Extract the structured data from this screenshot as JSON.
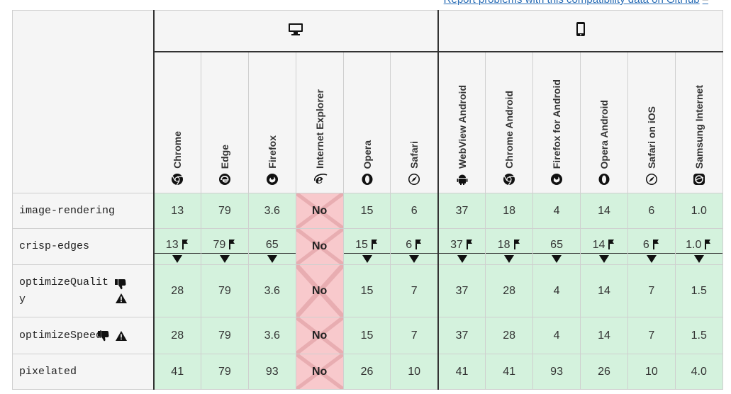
{
  "report_link": "Report problems with this compatibility data on GitHub",
  "platforms": [
    {
      "name": "desktop",
      "icon": "desktop-icon"
    },
    {
      "name": "mobile",
      "icon": "mobile-icon"
    }
  ],
  "browsers": [
    {
      "label": "Chrome",
      "icon": "chrome-icon"
    },
    {
      "label": "Edge",
      "icon": "edge-icon"
    },
    {
      "label": "Firefox",
      "icon": "firefox-icon"
    },
    {
      "label": "Internet Explorer",
      "icon": "ie-icon"
    },
    {
      "label": "Opera",
      "icon": "opera-icon"
    },
    {
      "label": "Safari",
      "icon": "safari-icon"
    },
    {
      "label": "WebView Android",
      "icon": "android-icon"
    },
    {
      "label": "Chrome Android",
      "icon": "chrome-icon"
    },
    {
      "label": "Firefox for Android",
      "icon": "firefox-icon"
    },
    {
      "label": "Opera Android",
      "icon": "opera-icon"
    },
    {
      "label": "Safari on iOS",
      "icon": "safari-icon"
    },
    {
      "label": "Samsung Internet",
      "icon": "samsung-icon"
    }
  ],
  "rows": [
    {
      "feature": "image-rendering",
      "icons": [],
      "values": [
        "13",
        "79",
        "3.6",
        "No",
        "15",
        "6",
        "37",
        "18",
        "4",
        "14",
        "6",
        "1.0"
      ]
    },
    {
      "feature": "crisp-edges",
      "icons": [],
      "values": [
        "13",
        "79",
        "65",
        "No",
        "15",
        "6",
        "37",
        "18",
        "65",
        "14",
        "6",
        "1.0"
      ]
    },
    {
      "feature": "optimizeQualit",
      "feature_wrap": "y",
      "icons": [
        "thumbs-down-icon",
        "warning-icon"
      ],
      "values": [
        "28",
        "79",
        "3.6",
        "No",
        "15",
        "7",
        "37",
        "28",
        "4",
        "14",
        "7",
        "1.5"
      ]
    },
    {
      "feature": "optimizeSpeed",
      "icons": [
        "thumbs-down-icon",
        "warning-icon"
      ],
      "values": [
        "28",
        "79",
        "3.6",
        "No",
        "15",
        "7",
        "37",
        "28",
        "4",
        "14",
        "7",
        "1.5"
      ]
    },
    {
      "feature": "pixelated",
      "icons": [],
      "values": [
        "41",
        "79",
        "93",
        "No",
        "26",
        "10",
        "41",
        "41",
        "93",
        "26",
        "10",
        "4.0"
      ]
    }
  ],
  "flags": {
    "crisp-edges": [
      true,
      true,
      false,
      false,
      true,
      true,
      true,
      true,
      false,
      true,
      true,
      true
    ]
  },
  "colors": {
    "supported_bg": "#d4f2dd",
    "unsupported_bg": "#f8c9cc",
    "header_bg": "#f5f5f5"
  }
}
